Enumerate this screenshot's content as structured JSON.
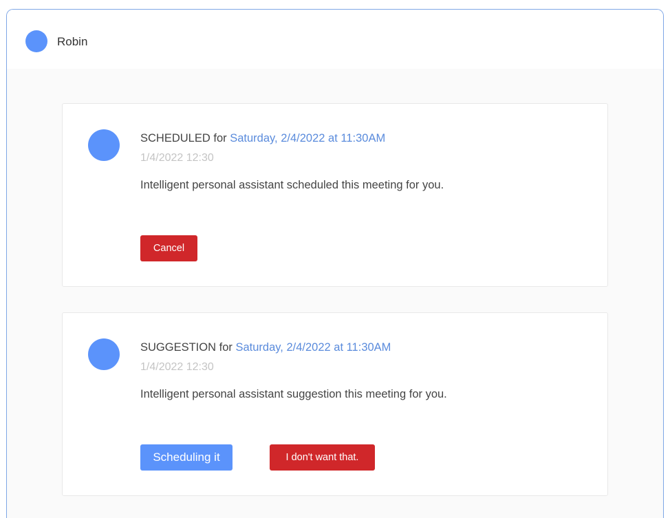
{
  "header": {
    "user_name": "Robin"
  },
  "cards": [
    {
      "status": "SCHEDULED",
      "for_text": "for",
      "date_link": "Saturday, 2/4/2022 at 11:30AM",
      "timestamp": "1/4/2022 12:30",
      "message": "Intelligent personal assistant scheduled this meeting for you.",
      "buttons": [
        {
          "label": "Cancel",
          "color": "#d0272a"
        }
      ]
    },
    {
      "status": "SUGGESTION",
      "for_text": "for",
      "date_link": "Saturday, 2/4/2022 at 11:30AM",
      "timestamp": "1/4/2022 12:30",
      "message": "Intelligent personal assistant suggestion this meeting for you.",
      "buttons": [
        {
          "label": "Scheduling it",
          "color": "#5b93fb"
        },
        {
          "label": "I don't want that.",
          "color": "#d0272a"
        }
      ]
    }
  ],
  "colors": {
    "accent_blue": "#5b93fb",
    "link_blue": "#5a8bdc",
    "danger_red": "#d0272a",
    "frame_border": "#7ea6e6"
  }
}
